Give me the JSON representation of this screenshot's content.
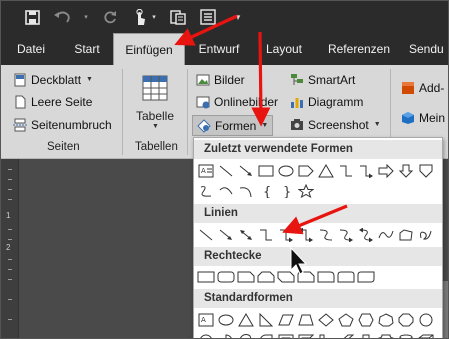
{
  "tabs": [
    "Datei",
    "Start",
    "Einfügen",
    "Entwurf",
    "Layout",
    "Referenzen",
    "Sendu"
  ],
  "active_tab": "Einfügen",
  "ribbon": {
    "seiten": {
      "deckblatt": "Deckblatt",
      "leere_seite": "Leere Seite",
      "seitenumbruch": "Seitenumbruch",
      "group_label": "Seiten"
    },
    "tabellen": {
      "tabelle": "Tabelle",
      "group_label": "Tabellen"
    },
    "illustrationen": {
      "bilder": "Bilder",
      "onlinebilder": "Onlinebilder",
      "formen": "Formen",
      "smartart": "SmartArt",
      "diagramm": "Diagramm",
      "screenshot": "Screenshot"
    },
    "addins": {
      "add": "Add-",
      "mein": "Mein"
    }
  },
  "dropdown": {
    "sections": [
      "Zuletzt verwendete Formen",
      "Linien",
      "Rechtecke",
      "Standardformen"
    ]
  },
  "ruler_numbers": [
    "1",
    "2"
  ],
  "colors": {
    "titlebar": "#2b2b2b",
    "ribbon": "#d8d8d8",
    "arrow": "#e8140f",
    "workspace": "#4a4a4a"
  },
  "icons": [
    "save-icon",
    "undo-icon",
    "redo-icon",
    "touch-mode-icon",
    "clipboard-icon",
    "list-icon",
    "customize-qat-icon"
  ]
}
